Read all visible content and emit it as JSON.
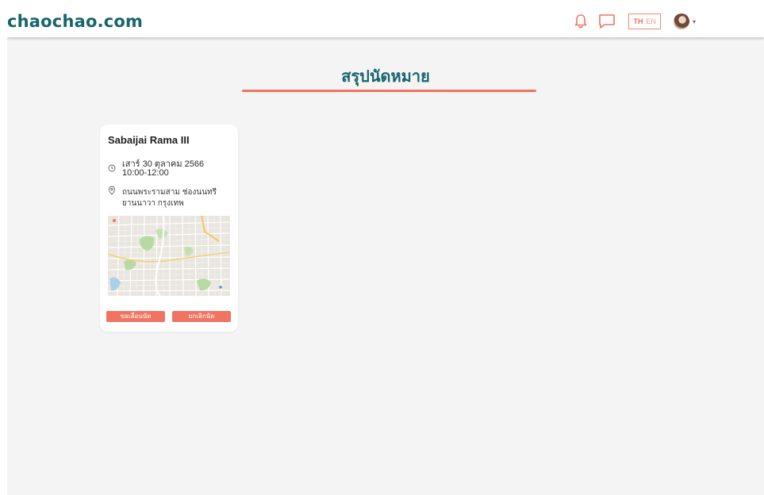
{
  "navbar": {
    "brand": "chaochao.com",
    "icons": [
      "bell-icon",
      "chat-icon"
    ],
    "lang": {
      "th": "TH",
      "en": "EN",
      "active": "TH"
    },
    "accent_color": "#ef7562",
    "brand_color": "#17646e"
  },
  "page": {
    "title": "สรุปนัดหมาย"
  },
  "appointment": {
    "name": "Sabaijai Rama III",
    "date": "เสาร์ 30 ตุลาคม 2566",
    "time": "10:00-12:00",
    "address_line1": "ถนนพระรามสาม ช่องนนทรี",
    "address_line2": "ยานนาวา กรุงเทพ",
    "postpone_label": "ขอเลื่อนนัด",
    "cancel_label": "ยกเลิกนัด"
  }
}
